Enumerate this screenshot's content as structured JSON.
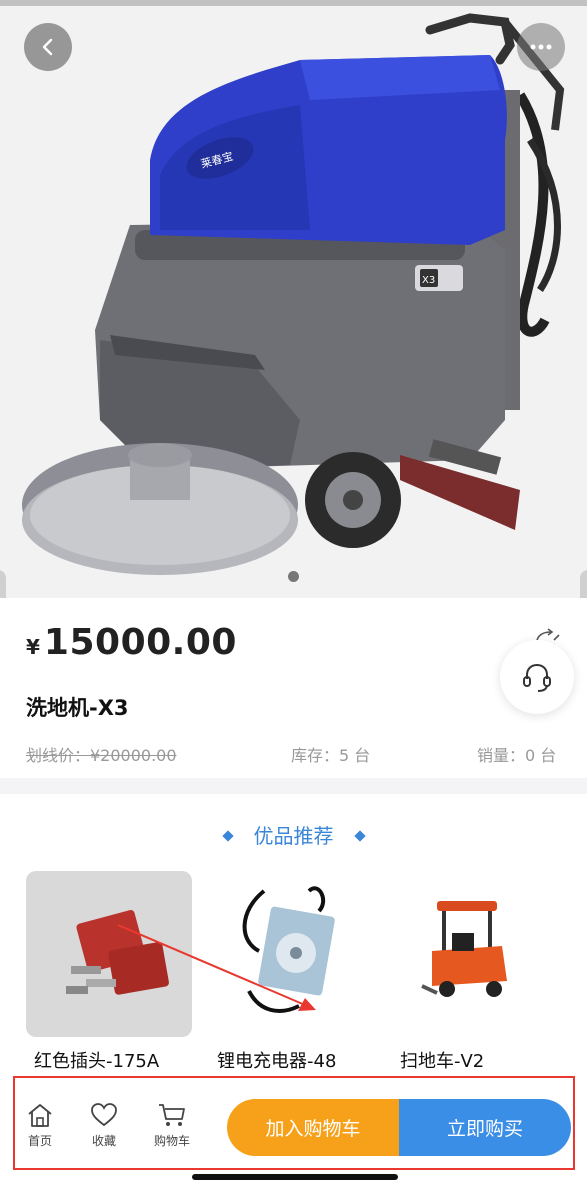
{
  "product": {
    "currency_symbol": "¥",
    "price": "15000.00",
    "name": "洗地机-X3",
    "original_price": "划线价：¥20000.00",
    "stock": "库存：5 台",
    "sales": "销量：0 台",
    "machine_badge": "X3",
    "brand_logo": "莱春宝"
  },
  "recommend": {
    "title": "优品推荐",
    "items": [
      {
        "name": "红色插头-175A",
        "icon": "red-plug-image"
      },
      {
        "name": "锂电充电器-48",
        "icon": "charger-image"
      },
      {
        "name": "扫地车-V2",
        "icon": "sweeper-image"
      }
    ]
  },
  "bottom_bar": {
    "home_label": "首页",
    "favorite_label": "收藏",
    "cart_label": "购物车",
    "add_to_cart": "加入购物车",
    "buy_now": "立即购买"
  },
  "colors": {
    "accent_blue": "#3a8ee6",
    "accent_orange": "#f7a11a",
    "annotation_red": "#e8382f"
  }
}
